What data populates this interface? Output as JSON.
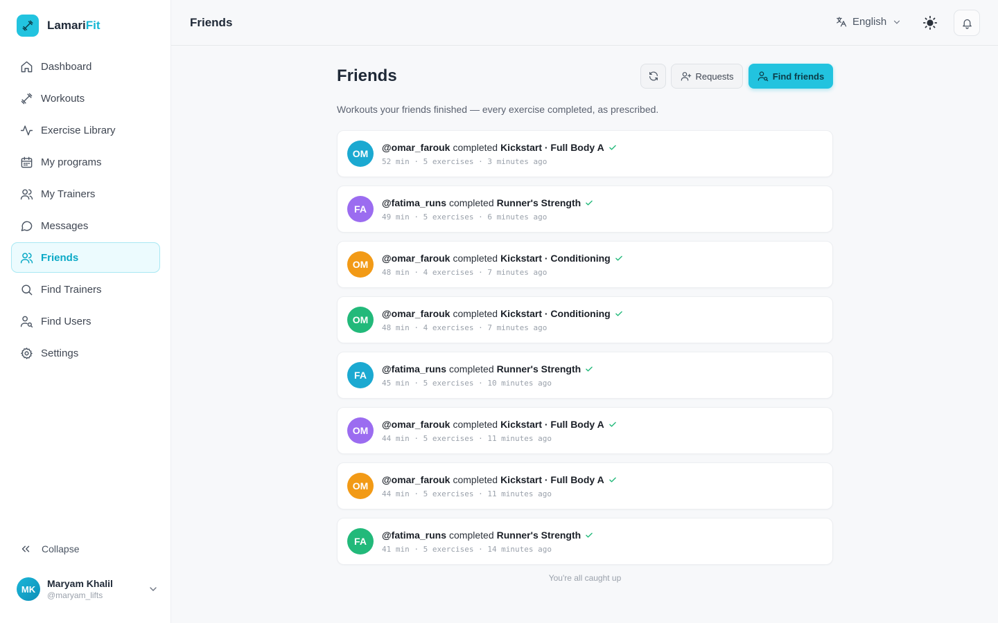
{
  "app": {
    "brand_main": "Lamari",
    "brand_accent": "Fit"
  },
  "sidebar": {
    "items": [
      {
        "label": "Dashboard",
        "icon": "home-icon"
      },
      {
        "label": "Workouts",
        "icon": "dumbbell-icon"
      },
      {
        "label": "Exercise Library",
        "icon": "activity-icon"
      },
      {
        "label": "My programs",
        "icon": "calendar-icon"
      },
      {
        "label": "My Trainers",
        "icon": "users-icon"
      },
      {
        "label": "Messages",
        "icon": "message-icon"
      },
      {
        "label": "Friends",
        "icon": "users-icon",
        "active": true
      },
      {
        "label": "Find Trainers",
        "icon": "search-icon"
      },
      {
        "label": "Find Users",
        "icon": "user-search-icon"
      },
      {
        "label": "Settings",
        "icon": "gear-icon"
      }
    ],
    "collapse_label": "Collapse",
    "user": {
      "initials": "MK",
      "name": "Maryam Khalil",
      "handle": "@maryam_lifts"
    }
  },
  "topbar": {
    "title": "Friends",
    "language": "English"
  },
  "page": {
    "title": "Friends",
    "requests_label": "Requests",
    "find_friends_label": "Find friends",
    "subtitle": "Workouts your friends finished — every exercise completed, as prescribed.",
    "caught_up": "You're all caught up"
  },
  "feed": [
    {
      "initials": "OM",
      "user": "@omar_farouk",
      "verb": "completed",
      "workout": "Kickstart · Full Body A",
      "meta": "52 min · 5 exercises · 3 minutes ago",
      "color": "#1ba9d1"
    },
    {
      "initials": "FA",
      "user": "@fatima_runs",
      "verb": "completed",
      "workout": "Runner's Strength",
      "meta": "49 min · 5 exercises · 6 minutes ago",
      "color": "#9b6cf0"
    },
    {
      "initials": "OM",
      "user": "@omar_farouk",
      "verb": "completed",
      "workout": "Kickstart · Conditioning",
      "meta": "48 min · 4 exercises · 7 minutes ago",
      "color": "#f29a16"
    },
    {
      "initials": "OM",
      "user": "@omar_farouk",
      "verb": "completed",
      "workout": "Kickstart · Conditioning",
      "meta": "48 min · 4 exercises · 7 minutes ago",
      "color": "#22b97a"
    },
    {
      "initials": "FA",
      "user": "@fatima_runs",
      "verb": "completed",
      "workout": "Runner's Strength",
      "meta": "45 min · 5 exercises · 10 minutes ago",
      "color": "#1ba9d1"
    },
    {
      "initials": "OM",
      "user": "@omar_farouk",
      "verb": "completed",
      "workout": "Kickstart · Full Body A",
      "meta": "44 min · 5 exercises · 11 minutes ago",
      "color": "#9b6cf0"
    },
    {
      "initials": "OM",
      "user": "@omar_farouk",
      "verb": "completed",
      "workout": "Kickstart · Full Body A",
      "meta": "44 min · 5 exercises · 11 minutes ago",
      "color": "#f29a16"
    },
    {
      "initials": "FA",
      "user": "@fatima_runs",
      "verb": "completed",
      "workout": "Runner's Strength",
      "meta": "41 min · 5 exercises · 14 minutes ago",
      "color": "#22b97a"
    }
  ]
}
